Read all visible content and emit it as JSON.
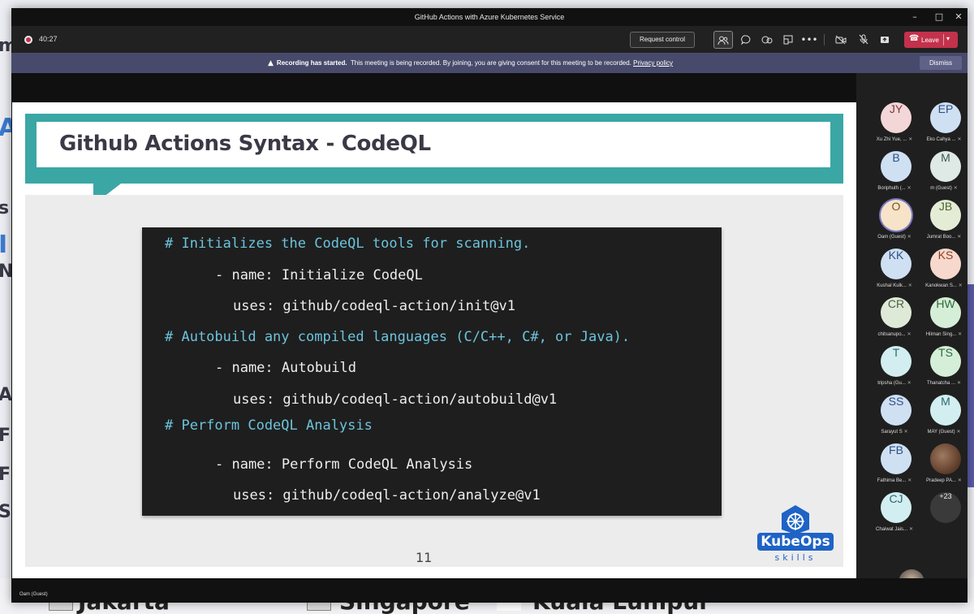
{
  "window": {
    "title": "GitHub Actions with Azure Kubernetes Service"
  },
  "toolbar": {
    "timer": "40:27",
    "request_control": "Request control",
    "leave": "Leave",
    "icons": [
      "people-icon",
      "chat-icon",
      "reactions-icon",
      "share-tray-icon",
      "more-icon",
      "camera-off-icon",
      "mic-off-icon",
      "share-icon"
    ]
  },
  "banner": {
    "bold": "Recording has started.",
    "message": "This meeting is being recorded. By joining, you are giving consent for this meeting to be recorded.",
    "link": "Privacy policy",
    "dismiss": "Dismiss"
  },
  "slide": {
    "title": "Github Actions Syntax - CodeQL",
    "code_lines": [
      "# Initializes the CodeQL tools for scanning.",
      "- name: Initialize CodeQL",
      "uses: github/codeql-action/init@v1",
      "# Autobuild any compiled languages (C/C++, C#, or Java).",
      "- name: Autobuild",
      "uses: github/codeql-action/autobuild@v1",
      "# Perform CodeQL Analysis",
      "- name: Perform CodeQL Analysis",
      "uses: github/codeql-action/analyze@v1"
    ],
    "page_number": "11",
    "logo_text": "KubeOps",
    "logo_sub": "skills"
  },
  "participants": [
    {
      "initials": "JY",
      "name": "Xu Zhi Yue, ...",
      "color": "#f3d6d8",
      "text": "#7a3a45"
    },
    {
      "initials": "EP",
      "name": "Eko Cahya ...",
      "color": "#cfe0f3",
      "text": "#2f4f80"
    },
    {
      "initials": "B",
      "name": "Boriphuth (...",
      "color": "#cfe0f3",
      "text": "#2f4f80"
    },
    {
      "initials": "M",
      "name": "m (Guest)",
      "color": "#dfe9e5",
      "text": "#3b5a50"
    },
    {
      "initials": "O",
      "name": "Oam (Guest)",
      "color": "#f6e3c8",
      "text": "#7b5524"
    },
    {
      "initials": "JB",
      "name": "Jumrat Boo...",
      "color": "#e4ecd5",
      "text": "#4f6632"
    },
    {
      "initials": "KK",
      "name": "Kushal Kulk...",
      "color": "#cfe0f3",
      "text": "#2f4f80"
    },
    {
      "initials": "KS",
      "name": "Kanokwan S...",
      "color": "#f7d8cc",
      "text": "#8a3e22"
    },
    {
      "initials": "CR",
      "name": "chitsanupo...",
      "color": "#dfe9d8",
      "text": "#4a6240"
    },
    {
      "initials": "HW",
      "name": "Hilman Sing...",
      "color": "#d5eed8",
      "text": "#2e6a3a"
    },
    {
      "initials": "T",
      "name": "tripsha (Gu...",
      "color": "#d3eef0",
      "text": "#2c6770"
    },
    {
      "initials": "TS",
      "name": "Thanatcha ...",
      "color": "#d5eed8",
      "text": "#2e6a3a"
    },
    {
      "initials": "SS",
      "name": "Sarayut S",
      "color": "#cfe0f3",
      "text": "#2f4f80"
    },
    {
      "initials": "M",
      "name": "MAY (Guest)",
      "color": "#d3eef0",
      "text": "#2c6770"
    },
    {
      "initials": "FB",
      "name": "Fathima Be...",
      "color": "#cfe0f3",
      "text": "#2f4f80"
    },
    {
      "initials": "",
      "name": "Pradeep PA...",
      "color": "",
      "text": ""
    },
    {
      "initials": "CJ",
      "name": "Chaiwat Jais...",
      "color": "#d3eef0",
      "text": "#2c6770"
    },
    {
      "initials": "+23",
      "name": "",
      "color": "",
      "text": ""
    }
  ],
  "status": {
    "name": "Oam (Guest)"
  },
  "background": {
    "letters": [
      "m",
      "A",
      "s",
      "I",
      "N",
      "A",
      "F",
      "F",
      "S"
    ],
    "bottom": [
      "Jakarta",
      "Singapore",
      "Kuala Lumpur"
    ]
  }
}
